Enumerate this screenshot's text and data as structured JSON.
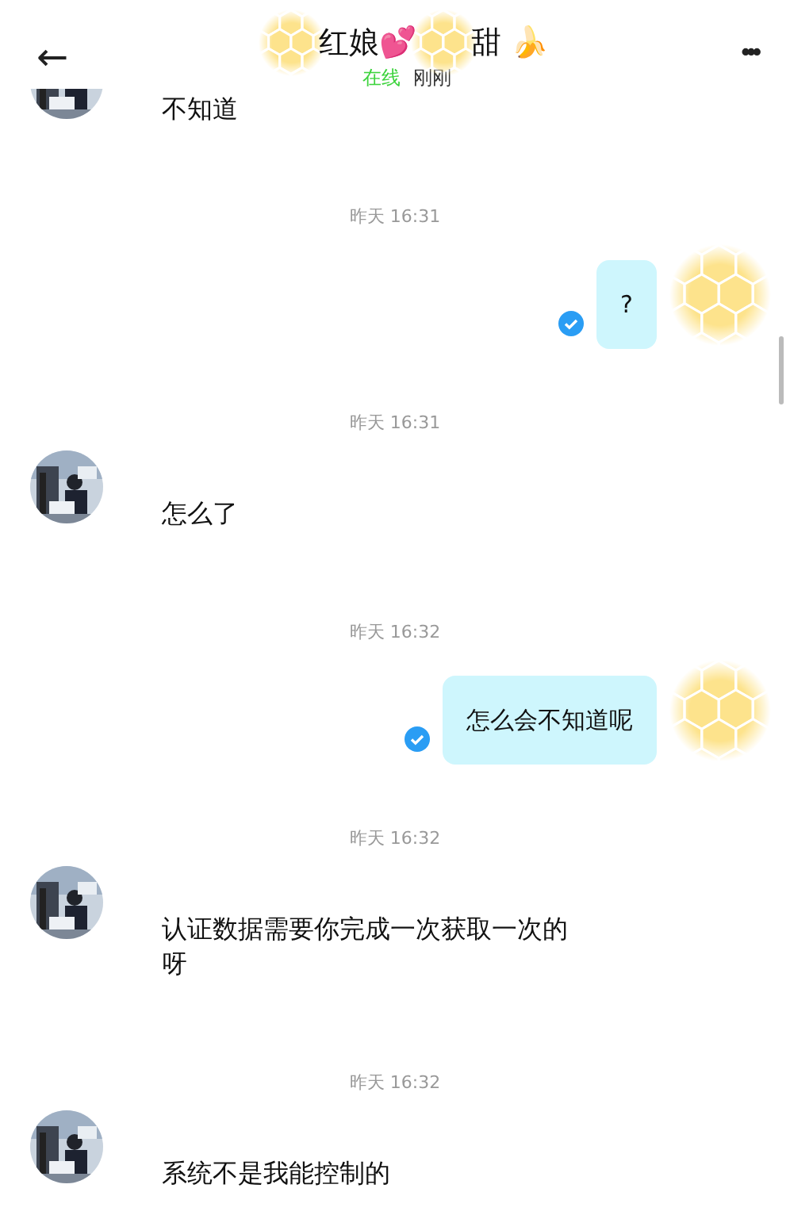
{
  "header": {
    "back": "←",
    "title_parts": [
      "红娘💕",
      "甜 🍌"
    ],
    "status": "在线",
    "last_seen": "刚刚",
    "more": "•••"
  },
  "messages": [
    {
      "kind": "incoming",
      "text": "不知道"
    },
    {
      "kind": "time",
      "text": "昨天 16:31"
    },
    {
      "kind": "outgoing",
      "text": "?",
      "read": true
    },
    {
      "kind": "time",
      "text": "昨天 16:31"
    },
    {
      "kind": "incoming",
      "text": "怎么了"
    },
    {
      "kind": "time",
      "text": "昨天 16:32"
    },
    {
      "kind": "outgoing",
      "text": "怎么会不知道呢",
      "read": true
    },
    {
      "kind": "time",
      "text": "昨天 16:32"
    },
    {
      "kind": "incoming",
      "text": "认证数据需要你完成一次获取一次的呀"
    },
    {
      "kind": "time",
      "text": "昨天 16:32"
    },
    {
      "kind": "incoming",
      "text": "系统不是我能控制的"
    }
  ]
}
